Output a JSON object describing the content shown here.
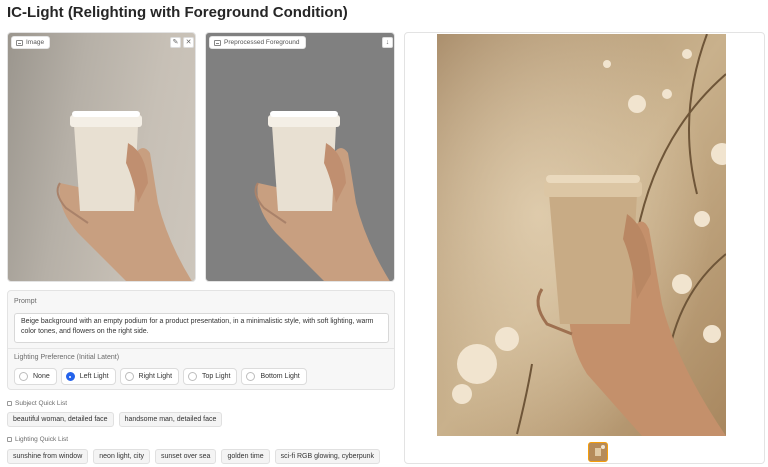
{
  "page": {
    "title": "IC-Light (Relighting with Foreground Condition)"
  },
  "input_image": {
    "label": "Image",
    "edit_icon": "pencil-icon",
    "clear_icon": "close-icon"
  },
  "preprocessed": {
    "label": "Preprocessed Foreground",
    "download_icon": "download-icon"
  },
  "prompt": {
    "label": "Prompt",
    "value": "Beige background with an empty podium for a product presentation, in a minimalistic style, with soft lighting, warm color tones, and flowers on the right side."
  },
  "lighting": {
    "label": "Lighting Preference (Initial Latent)",
    "options": [
      "None",
      "Left Light",
      "Right Light",
      "Top Light",
      "Bottom Light"
    ],
    "selected": "Left Light"
  },
  "subject_quick_list": {
    "label": "Subject Quick List",
    "items": [
      "beautiful woman, detailed face",
      "handsome man, detailed face"
    ]
  },
  "lighting_quick_list": {
    "label": "Lighting Quick List",
    "items": [
      "sunshine from window",
      "neon light, city",
      "sunset over sea",
      "golden time",
      "sci-fi RGB glowing, cyberpunk"
    ]
  },
  "colors": {
    "accent": "#2563eb",
    "thumb_border": "#f59e0b",
    "gray_bg": "#808080",
    "warm_bg": "#c9b18c"
  }
}
